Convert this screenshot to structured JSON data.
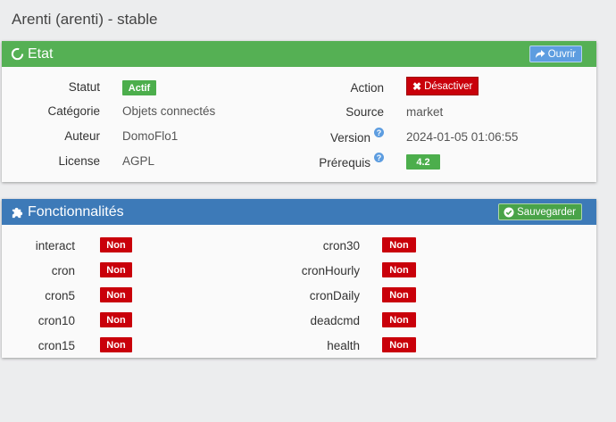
{
  "page": {
    "title": "Arenti (arenti) - stable"
  },
  "etat": {
    "header": "Etat",
    "open_button": "Ouvrir",
    "statut_label": "Statut",
    "statut_value": "Actif",
    "categorie_label": "Catégorie",
    "categorie_value": "Objets connectés",
    "auteur_label": "Auteur",
    "auteur_value": "DomoFlo1",
    "license_label": "License",
    "license_value": "AGPL",
    "action_label": "Action",
    "action_button": "Désactiver",
    "source_label": "Source",
    "source_value": "market",
    "version_label": "Version",
    "version_value": "2024-01-05 01:06:55",
    "prerequis_label": "Prérequis",
    "prerequis_value": "4.2",
    "help_glyph": "?"
  },
  "func": {
    "header": "Fonctionnalités",
    "save_button": "Sauvegarder",
    "left": [
      {
        "name": "interact",
        "value": "Non"
      },
      {
        "name": "cron",
        "value": "Non"
      },
      {
        "name": "cron5",
        "value": "Non"
      },
      {
        "name": "cron10",
        "value": "Non"
      },
      {
        "name": "cron15",
        "value": "Non"
      }
    ],
    "right": [
      {
        "name": "cron30",
        "value": "Non"
      },
      {
        "name": "cronHourly",
        "value": "Non"
      },
      {
        "name": "cronDaily",
        "value": "Non"
      },
      {
        "name": "deadcmd",
        "value": "Non"
      },
      {
        "name": "health",
        "value": "Non"
      }
    ]
  },
  "colors": {
    "etat_header": "#55b054",
    "func_header": "#3d7ab8",
    "active_badge": "#4cae4c",
    "inactive_badge": "#c9000a",
    "open_button": "#5d9de0"
  },
  "icons": {
    "etat": "circle-notch-icon",
    "open": "share-arrow-icon",
    "func": "puzzle-icon",
    "save": "check-circle-icon",
    "deactivate": "times-icon",
    "help": "question-circle-icon"
  }
}
